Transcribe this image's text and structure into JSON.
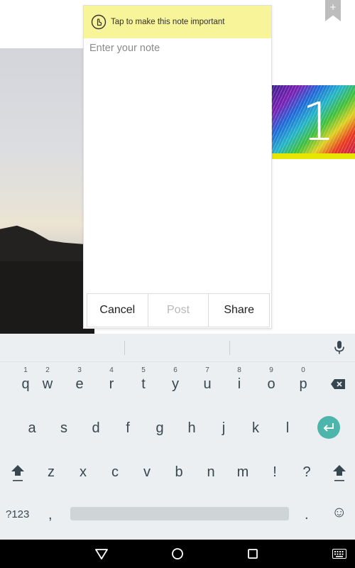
{
  "background": {
    "bookmark_label": "+",
    "tile_number": "1"
  },
  "note": {
    "banner_text": "Tap to make this note important",
    "input_placeholder": "Enter your note",
    "input_value": "",
    "actions": {
      "cancel": "Cancel",
      "post": "Post",
      "share": "Share"
    }
  },
  "keyboard": {
    "row1": [
      {
        "key": "q",
        "hint": "1"
      },
      {
        "key": "w",
        "hint": "2"
      },
      {
        "key": "e",
        "hint": "3"
      },
      {
        "key": "r",
        "hint": "4"
      },
      {
        "key": "t",
        "hint": "5"
      },
      {
        "key": "y",
        "hint": "6"
      },
      {
        "key": "u",
        "hint": "7"
      },
      {
        "key": "i",
        "hint": "8"
      },
      {
        "key": "o",
        "hint": "9"
      },
      {
        "key": "p",
        "hint": "0"
      }
    ],
    "row2": [
      "a",
      "s",
      "d",
      "f",
      "g",
      "h",
      "j",
      "k",
      "l"
    ],
    "row3": [
      "z",
      "x",
      "c",
      "v",
      "b",
      "n",
      "m",
      "!",
      "?"
    ],
    "symbols_key": "?123",
    "comma_key": ",",
    "period_key": ".",
    "emoji_key": "☺",
    "colors": {
      "background": "#eceff1",
      "key_text": "#37474f",
      "enter_accent": "#4db6ac"
    }
  },
  "colors": {
    "banner": "#f8f49a",
    "tile_bar": "#e6e600"
  }
}
